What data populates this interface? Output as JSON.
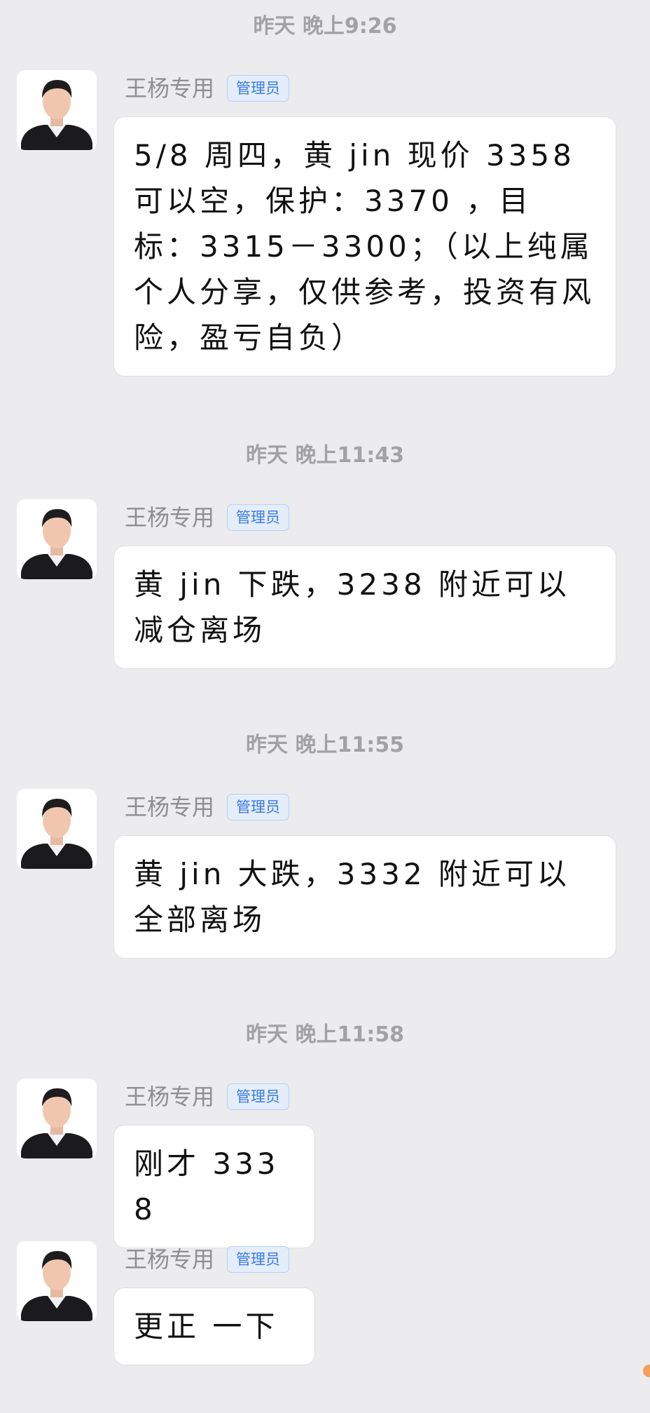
{
  "sender": {
    "name": "王杨专用",
    "role": "管理员"
  },
  "messages": [
    {
      "time": "昨天 晚上9:26",
      "text": "5/8 周四，黄 jin 现价 3358 可以空，保护：3370 ，目标：3315－3300；（以上纯属个人分享，仅供参考，投资有风险，盈亏自负）"
    },
    {
      "time": "昨天 晚上11:43",
      "text": "黄 jin 下跌，3238 附近可以减仓离场"
    },
    {
      "time": "昨天 晚上11:55",
      "text": "黄 jin 大跌，3332 附近可以全部离场"
    },
    {
      "time": "昨天 晚上11:58",
      "text": "刚才 3338"
    },
    {
      "time": "",
      "text": "更正 一下"
    }
  ],
  "icons": {
    "avatar": "person-portrait-icon"
  },
  "colors": {
    "background": "#ececee",
    "bubble": "#ffffff",
    "badge_text": "#3a7be0",
    "badge_bg": "#e4edfa"
  }
}
